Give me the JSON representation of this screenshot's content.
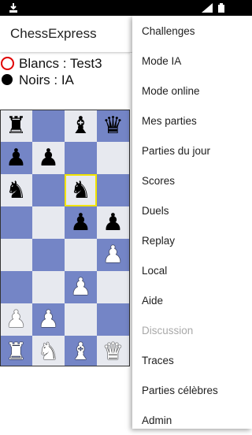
{
  "statusbar": {
    "left_icon": "download-icon",
    "signal_icon": "signal-icon",
    "battery_icon": "battery-icon"
  },
  "app": {
    "title": "ChessExpress"
  },
  "players": {
    "white": {
      "label": "Blancs : Test3",
      "marker": "red-circle",
      "marker_color": "#e00000"
    },
    "black": {
      "label": "Noirs : IA",
      "marker": "black-dot"
    }
  },
  "board": {
    "dark_color": "#7485c6",
    "light_color": "#e7e9ef",
    "selected_color": "#f2e400",
    "rows": [
      [
        "br",
        "",
        "bb",
        "bq"
      ],
      [
        "bp",
        "bp",
        "",
        ""
      ],
      [
        "bn",
        "",
        "bn",
        ""
      ],
      [
        "",
        "",
        "bp",
        "bp"
      ],
      [
        "",
        "",
        "",
        "wp"
      ],
      [
        "",
        "",
        "wp",
        ""
      ],
      [
        "wp",
        "wp",
        "",
        ""
      ],
      [
        "wr",
        "wn",
        "wb",
        "wq"
      ]
    ],
    "selected": "row 3, column 3"
  },
  "menu": {
    "items": [
      {
        "label": "Challenges",
        "enabled": true
      },
      {
        "label": "Mode IA",
        "enabled": true
      },
      {
        "label": "Mode online",
        "enabled": true
      },
      {
        "label": "Mes parties",
        "enabled": true
      },
      {
        "label": "Parties du jour",
        "enabled": true
      },
      {
        "label": "Scores",
        "enabled": true
      },
      {
        "label": "Duels",
        "enabled": true
      },
      {
        "label": "Replay",
        "enabled": true
      },
      {
        "label": "Local",
        "enabled": true
      },
      {
        "label": "Aide",
        "enabled": true
      },
      {
        "label": "Discussion",
        "enabled": false
      },
      {
        "label": "Traces",
        "enabled": true
      },
      {
        "label": "Parties célèbres",
        "enabled": true
      },
      {
        "label": "Admin",
        "enabled": true
      }
    ]
  }
}
